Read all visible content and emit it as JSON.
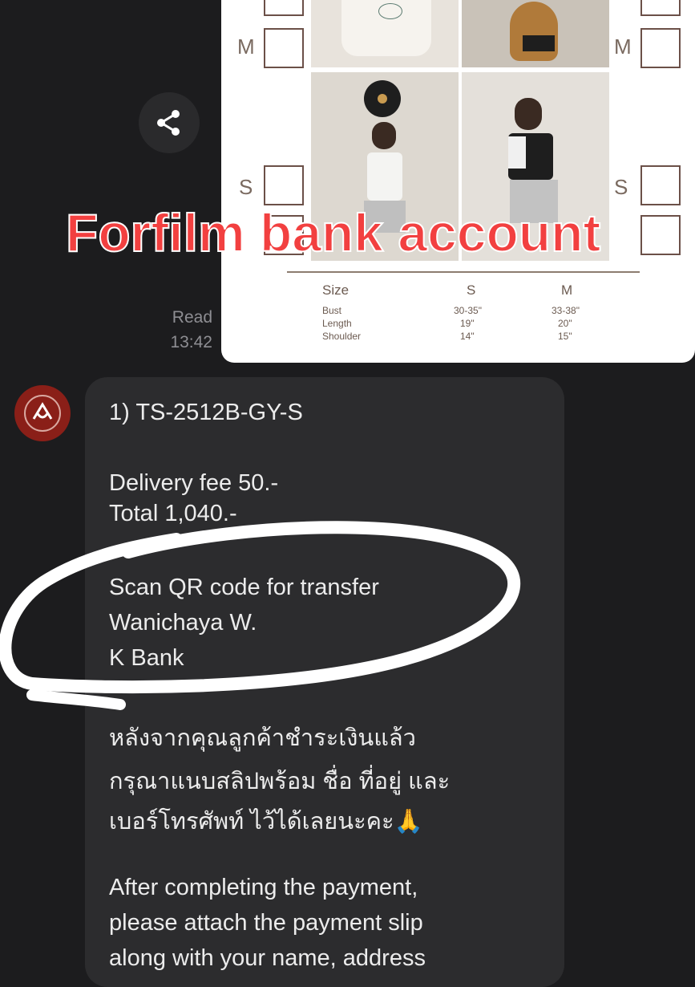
{
  "overlay": {
    "title": "Forfilm bank account"
  },
  "product_card": {
    "size_labels": {
      "top_right_m": "M",
      "top_left_m": "M",
      "mid_left_s": "S",
      "mid_right_s": "S"
    },
    "table": {
      "headers": [
        "Size",
        "S",
        "M"
      ],
      "rows": [
        {
          "label": "Bust",
          "s": "30-35\"",
          "m": "33-38\""
        },
        {
          "label": "Length",
          "s": "19\"",
          "m": "20\""
        },
        {
          "label": "Shoulder",
          "s": "14\"",
          "m": "15\""
        }
      ]
    }
  },
  "chat": {
    "share_icon": "share-icon",
    "read_status": "Read",
    "read_time": "13:42",
    "message": {
      "order_line": "1) TS-2512B-GY-S",
      "delivery_fee": "Delivery fee 50.-",
      "total": "Total 1,040.-",
      "scan_qr": "Scan QR code for transfer",
      "account_name": "Wanichaya W.",
      "bank": "K Bank",
      "thai_line1": "หลังจากคุณลูกค้าชำระเงินแล้ว",
      "thai_line2": "กรุณาแนบสลิปพร้อม ชื่อ ที่อยู่ และ",
      "thai_line3": "เบอร์โทรศัพท์ ไว้ได้เลยนะคะ🙏",
      "en_line1": "After completing the payment,",
      "en_line2": "please attach the payment slip",
      "en_line3": "along with your name, address"
    }
  },
  "colors": {
    "background": "#1c1c1e",
    "bubble": "#2c2c2e",
    "overlay_text": "#f24040",
    "avatar": "#8a1f18"
  }
}
